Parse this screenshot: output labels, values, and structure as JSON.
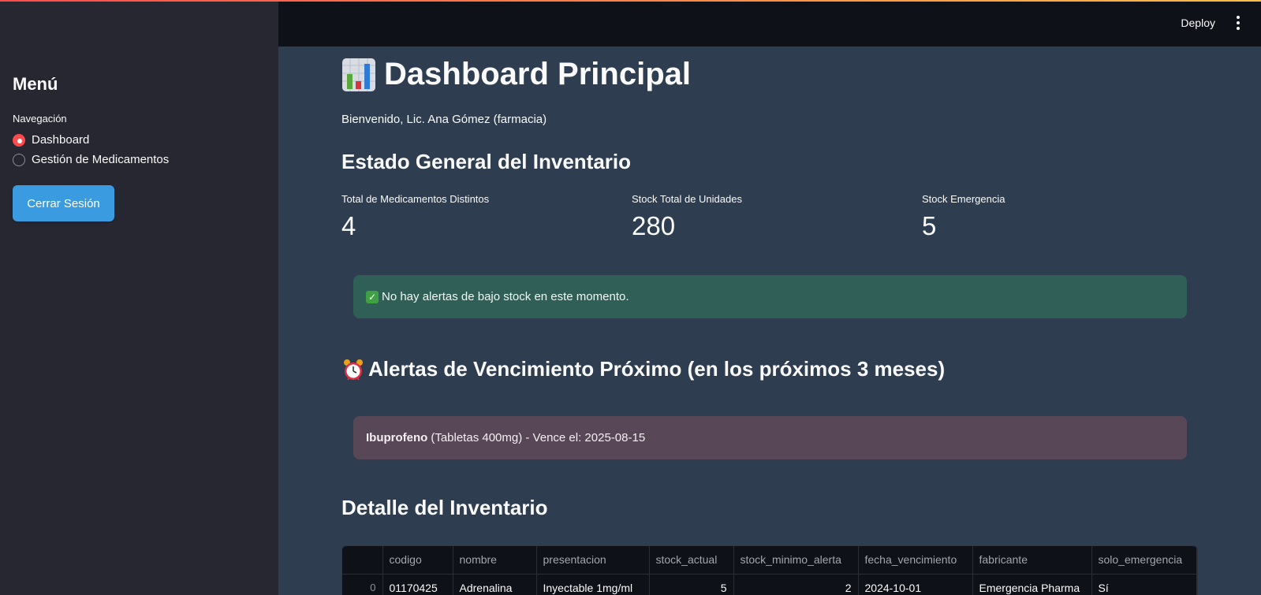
{
  "header": {
    "deploy_label": "Deploy"
  },
  "sidebar": {
    "title": "Menú",
    "nav_label": "Navegación",
    "items": [
      {
        "label": "Dashboard",
        "selected": true
      },
      {
        "label": "Gestión de Medicamentos",
        "selected": false
      }
    ],
    "logout_label": "Cerrar Sesión"
  },
  "main": {
    "title": "Dashboard Principal",
    "title_icon": "bar-chart-icon",
    "welcome": "Bienvenido, Lic. Ana Gómez (farmacia)",
    "inventory_heading": "Estado General del Inventario",
    "metrics": [
      {
        "label": "Total de Medicamentos Distintos",
        "value": "4"
      },
      {
        "label": "Stock Total de Unidades",
        "value": "280"
      },
      {
        "label": "Stock Emergencia",
        "value": "5"
      }
    ],
    "stock_alert": {
      "icon": "check-icon",
      "text": "No hay alertas de bajo stock en este momento."
    },
    "expiry_heading": "Alertas de Vencimiento Próximo (en los próximos 3 meses)",
    "expiry_icon": "alarm-clock-icon",
    "expiry_alert": {
      "name": "Ibuprofeno",
      "detail": "(Tabletas 400mg) - Vence el: 2025-08-15"
    },
    "detail_heading": "Detalle del Inventario",
    "table": {
      "columns": [
        "codigo",
        "nombre",
        "presentacion",
        "stock_actual",
        "stock_minimo_alerta",
        "fecha_vencimiento",
        "fabricante",
        "solo_emergencia"
      ],
      "rows": [
        {
          "index": "0",
          "codigo": "01170425",
          "nombre": "Adrenalina",
          "presentacion": "Inyectable 1mg/ml",
          "stock_actual": "5",
          "stock_minimo_alerta": "2",
          "fecha_vencimiento": "2024-10-01",
          "fabricante": "Emergencia Pharma",
          "solo_emergencia": "Sí"
        }
      ]
    }
  },
  "colors": {
    "accent": "#ff4b4b",
    "button": "#3b9be0",
    "success_bg": "#2f5f56",
    "error_bg": "#584857"
  }
}
